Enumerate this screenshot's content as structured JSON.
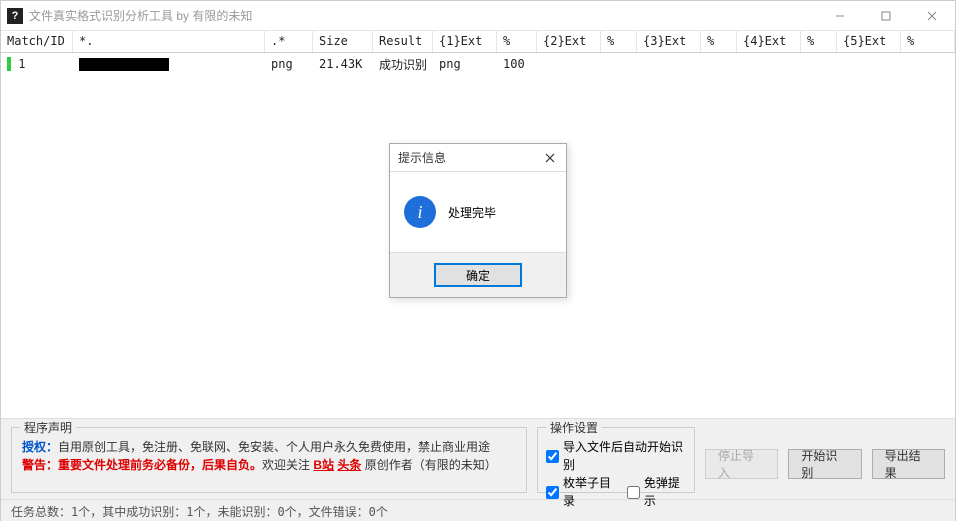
{
  "window": {
    "title": "文件真实格式识别分析工具 by 有限的未知",
    "icon_text": "?"
  },
  "columns": [
    "Match/ID",
    "*.",
    ".*",
    "Size",
    "Result",
    "{1}Ext",
    "%",
    "{2}Ext",
    "%",
    "{3}Ext",
    "%",
    "{4}Ext",
    "%",
    "{5}Ext",
    "%"
  ],
  "rows": [
    {
      "match_id": "1",
      "filename_redacted": true,
      "origext": "png",
      "size": "21.43K",
      "result": "成功识别",
      "ext1": "png",
      "pct1": "100",
      "ext2": "",
      "pct2": "",
      "ext3": "",
      "pct3": "",
      "ext4": "",
      "pct4": "",
      "ext5": "",
      "pct5": ""
    }
  ],
  "program_desc": {
    "legend": "程序声明",
    "line1_prefix": "授权：",
    "line1_rest": "自用原创工具，免注册、免联网、免安装、个人用户永久免费使用，禁止商业用途",
    "line2_prefix": "警告：",
    "line2_part_a": "重要文件处理前务必备份，后果自负。",
    "line2_part_b": "欢迎关注 ",
    "line2_link1": "B站",
    "line2_link2": "头条",
    "line2_part_c": " 原创作者（有限的未知）"
  },
  "op_settings": {
    "legend": "操作设置",
    "cb1_label": "导入文件后自动开始识别",
    "cb1_checked": true,
    "cb2_label": "枚举子目录",
    "cb2_checked": true,
    "cb3_label": "免弹提示",
    "cb3_checked": false
  },
  "buttons": {
    "stop_import": "停止导入",
    "start_recognize": "开始识别",
    "export_result": "导出结果"
  },
  "statusbar": "任务总数：1个，其中成功识别：1个，未能识别：0个，文件错误：0个",
  "modal": {
    "title": "提示信息",
    "message": "处理完毕",
    "ok": "确定"
  }
}
